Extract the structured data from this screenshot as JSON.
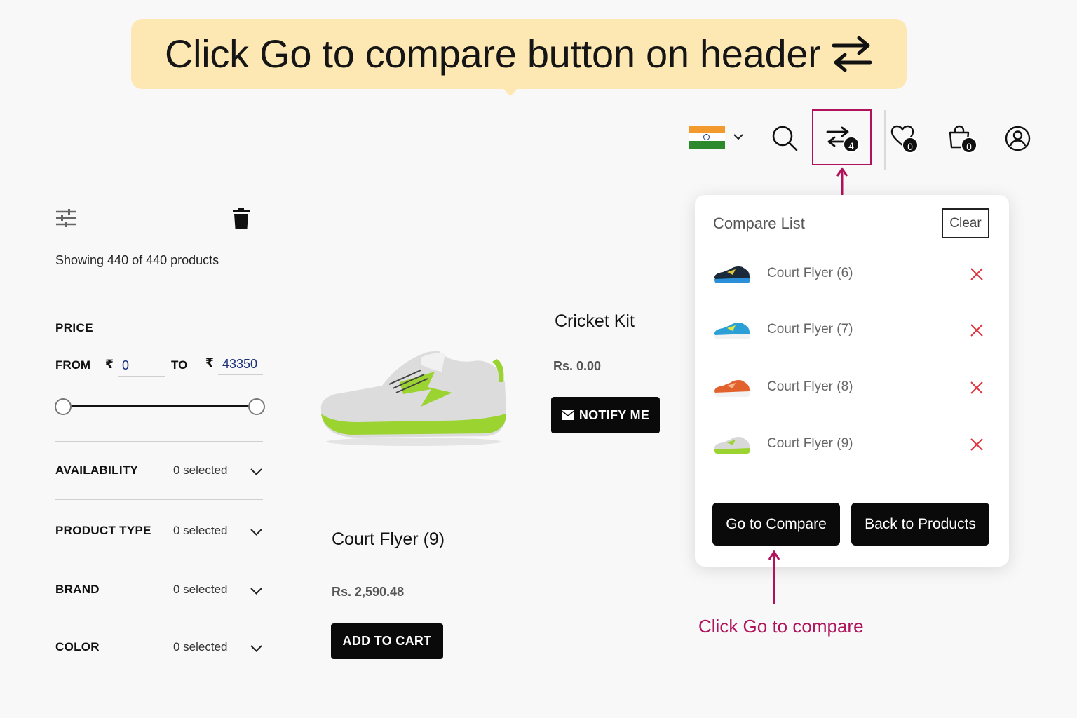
{
  "callout": {
    "text": "Click Go to compare button on header",
    "icon": "compare-arrows-icon"
  },
  "header": {
    "country_flag": "india-flag-icon",
    "compare_count": "4",
    "wishlist_count": "0",
    "cart_count": "0"
  },
  "sidebar": {
    "showing_text": "Showing 440 of 440 products",
    "price": {
      "title": "PRICE",
      "from_label": "FROM",
      "to_label": "TO",
      "currency": "₹",
      "from_value": "0",
      "to_value": "43350"
    },
    "facets": [
      {
        "label": "AVAILABILITY",
        "count": "0 selected"
      },
      {
        "label": "PRODUCT TYPE",
        "count": "0 selected"
      },
      {
        "label": "BRAND",
        "count": "0 selected"
      },
      {
        "label": "COLOR",
        "count": "0 selected"
      }
    ]
  },
  "products": [
    {
      "title": "Cricket Kit",
      "price": "Rs. 0.00",
      "button": "NOTIFY ME"
    },
    {
      "title": "Court Flyer (9)",
      "price": "Rs. 2,590.48",
      "button": "ADD TO CART"
    }
  ],
  "compare_panel": {
    "title": "Compare List",
    "clear_label": "Clear",
    "items": [
      {
        "name": "Court Flyer (6)",
        "color": "#1b2a3a",
        "accent": "#2a8fd8"
      },
      {
        "name": "Court Flyer (7)",
        "color": "#2b9fd6",
        "accent": "#f2f2f2"
      },
      {
        "name": "Court Flyer (8)",
        "color": "#e2622d",
        "accent": "#f2f2f2"
      },
      {
        "name": "Court Flyer (9)",
        "color": "#d8d8d8",
        "accent": "#9bd330"
      }
    ],
    "go_label": "Go to Compare",
    "back_label": "Back to Products"
  },
  "annotation": {
    "text": "Click Go to compare",
    "color": "#b0135c"
  }
}
